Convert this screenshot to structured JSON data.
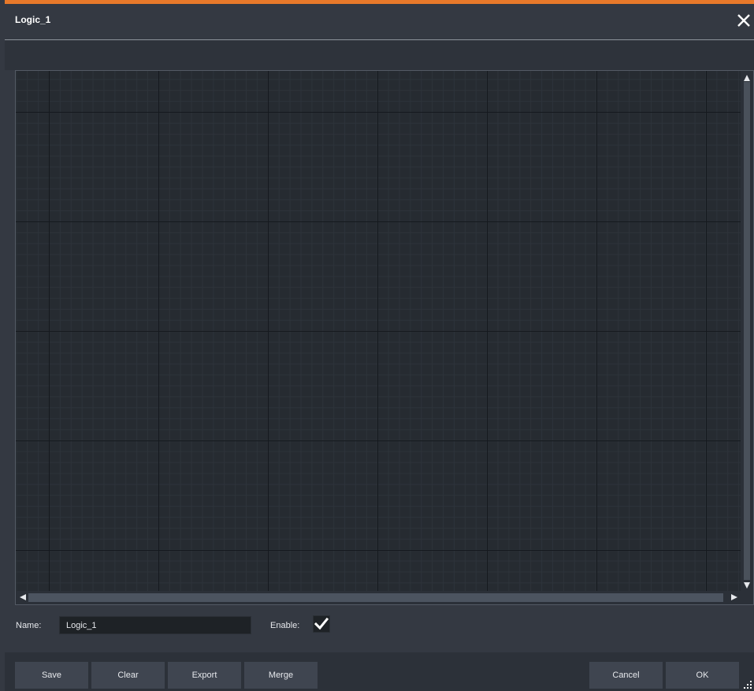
{
  "dialog": {
    "title": "Logic_1",
    "accent_color": "#e8792a"
  },
  "icons": {
    "close": "close-icon",
    "check": "checkmark-icon",
    "scroll_up": "arrow-up-icon",
    "scroll_down": "arrow-down-icon",
    "scroll_left": "arrow-left-icon",
    "scroll_right": "arrow-right-icon",
    "resize": "resize-grip-icon"
  },
  "form": {
    "name_label": "Name:",
    "name_value": "Logic_1",
    "enable_label": "Enable:",
    "enable_checked": true
  },
  "footer": {
    "save_label": "Save",
    "clear_label": "Clear",
    "export_label": "Export",
    "merge_label": "Merge",
    "cancel_label": "Cancel",
    "ok_label": "OK"
  }
}
